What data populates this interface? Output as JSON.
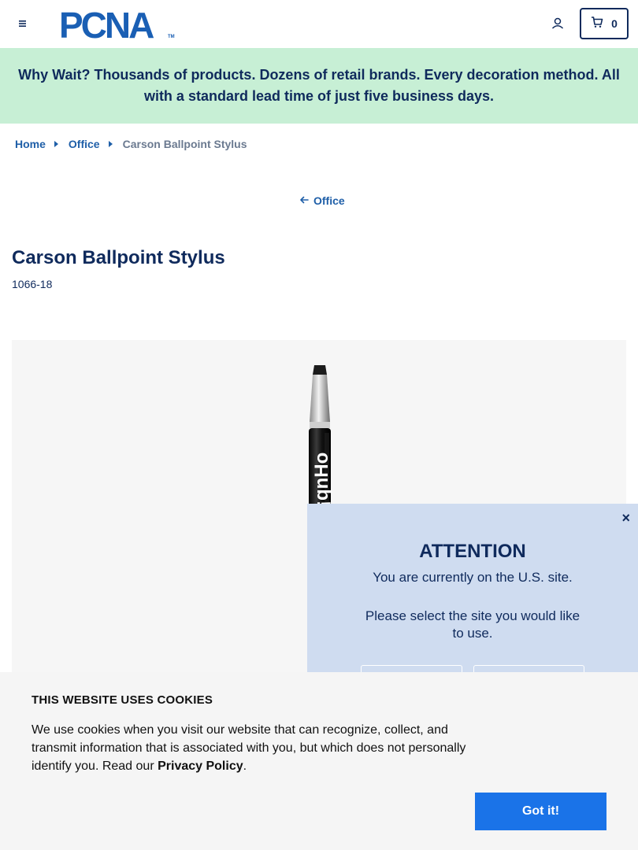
{
  "header": {
    "logo_text": "PCNA",
    "logo_tm": "TM",
    "cart_count": "0"
  },
  "promo": {
    "text": "Why Wait? Thousands of products. Dozens of retail brands. Every decoration method. All with a standard lead time of just five business days."
  },
  "breadcrumb": {
    "items": [
      {
        "label": "Home"
      },
      {
        "label": "Office"
      }
    ],
    "current": "Carson Ballpoint Stylus"
  },
  "back_link": {
    "label": "Office"
  },
  "product": {
    "title": "Carson Ballpoint Stylus",
    "sku": "1066-18",
    "imprint_text": "¡qnHo"
  },
  "attention_modal": {
    "close_label": "×",
    "title": "ATTENTION",
    "line1": "You are currently on the U.S. site.",
    "line2": "Please select the site you would like to use."
  },
  "cookie_banner": {
    "title": "THIS WEBSITE USES COOKIES",
    "text_before": "We use cookies when you visit our website that can recognize, collect, and transmit information that is associated with you, but which does not personally identify you. Read our ",
    "link_label": "Privacy Policy",
    "text_after": ".",
    "button_label": "Got it!"
  },
  "colors": {
    "brand_navy": "#0f2a5c",
    "link_blue": "#1f5fa8",
    "promo_bg": "#c7efd5",
    "modal_bg": "#cfdcf0",
    "cookie_button": "#1a73e8"
  },
  "icons": {
    "menu": "hamburger-menu-icon",
    "account": "user-icon",
    "cart": "cart-icon",
    "back": "arrow-left-icon",
    "crumb_sep": "caret-right-icon"
  }
}
